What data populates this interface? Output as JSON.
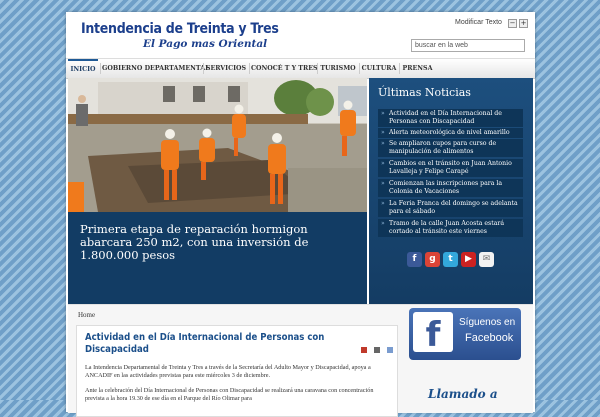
{
  "header": {
    "logo_title": "Intendencia de Treinta y Tres",
    "logo_subtitle": "El Pago mas Oriental",
    "modify_text_label": "Modificar Texto",
    "decrease_symbol": "−",
    "increase_symbol": "+",
    "search_placeholder": "buscar en la web"
  },
  "nav": {
    "items": [
      "INICIO",
      "GOBIERNO DEPARTAMENTAL",
      "SERVICIOS",
      "CONOCÉ T Y TRES",
      "TURISMO",
      "CULTURA",
      "PRENSA"
    ],
    "active": "INICIO"
  },
  "hero": {
    "caption": "Primera etapa de reparación hormigon abarcara 250 m2, con una inversión de 1.800.000 pesos"
  },
  "news": {
    "title": "Últimas Noticias",
    "items": [
      "Actividad en el Día Internacional de Personas con Discapacidad",
      "Alerta meteorológica de nivel amarillo",
      "Se ampliaron cupos para curso de manipulación de alimentos",
      "Cambios en el tránsito en Juan Antonio Lavalleja y Felipe Carapé",
      "Comienzan las inscripciones para la Colonia de Vacaciones",
      "La Feria Franca del domingo se adelanta para el sábado",
      "Tramo de la calle Juan Acosta estará cortado al tránsito este viernes"
    ],
    "social_icons": [
      "facebook-icon",
      "google-icon",
      "twitter-icon",
      "youtube-icon",
      "email-icon"
    ]
  },
  "content": {
    "breadcrumb": "Home",
    "article_title": "Actividad en el Día Internacional de Personas con Discapacidad",
    "paragraph1": "La Intendencia Departamental de Treinta y Tres a través de la Secretaría del Adulto Mayor y Discapacidad, apoya a ANCADIF en las actividades previstas para este miércoles 3 de diciembre.",
    "paragraph2": "Ante la celebración del Día Internacional de Personas con Discapacidad se realizará una caravana con concentración prevista a la hora 19.30 de ese día en el Parque del Río Olimar para"
  },
  "sidebar": {
    "facebook_line1": "Síguenos en",
    "facebook_line2": "Facebook",
    "llamado": "Llamado a"
  },
  "colors": {
    "brand_blue": "#1c3f8c",
    "news_bg": "#1d4f7e",
    "article_title": "#1b4f8a"
  }
}
